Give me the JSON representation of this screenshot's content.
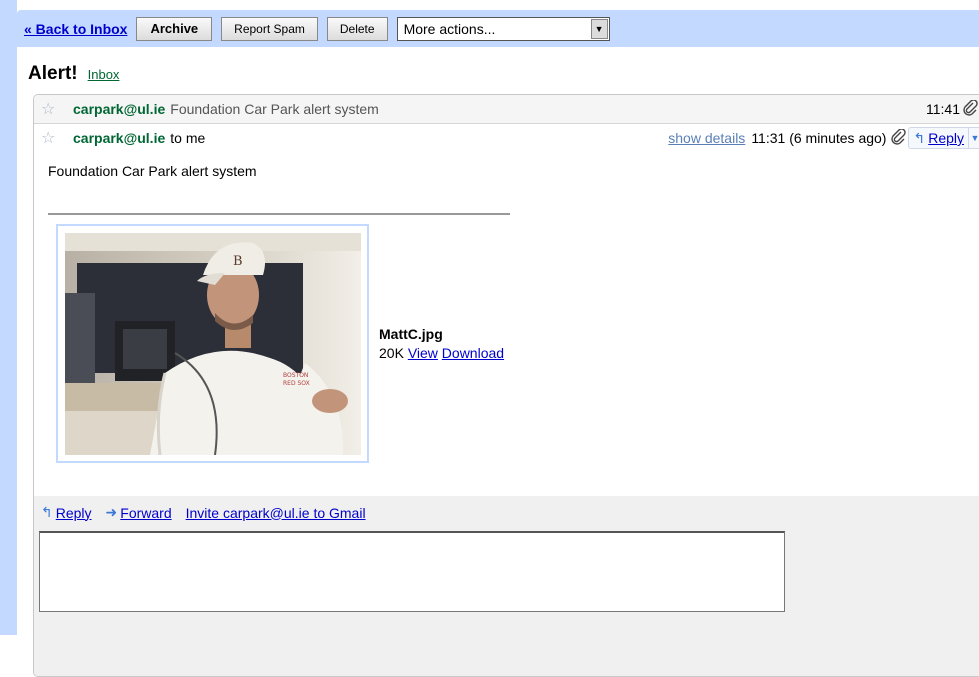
{
  "toolbar": {
    "back_label": "« Back to Inbox",
    "archive_label": "Archive",
    "spam_label": "Report Spam",
    "delete_label": "Delete",
    "more_actions": "More actions..."
  },
  "conversation": {
    "subject": "Alert!",
    "label": "Inbox"
  },
  "messages": [
    {
      "sender": "carpark@ul.ie",
      "snippet": "Foundation Car Park alert system",
      "time": "11:41"
    },
    {
      "sender": "carpark@ul.ie",
      "to": "to me",
      "show_details": "show details",
      "time": "11:31 (6 minutes ago)",
      "reply_label": "Reply",
      "body": "Foundation Car Park alert system",
      "attachment": {
        "filename": "MattC.jpg",
        "size": "20K",
        "view_label": "View",
        "download_label": "Download"
      }
    }
  ],
  "footer": {
    "reply_label": "Reply",
    "forward_label": "Forward",
    "invite_label": "Invite carpark@ul.ie to Gmail"
  },
  "colors": {
    "toolbar_bg": "#c3d9ff",
    "sender_green": "#006633",
    "link_blue": "#0000cc"
  }
}
